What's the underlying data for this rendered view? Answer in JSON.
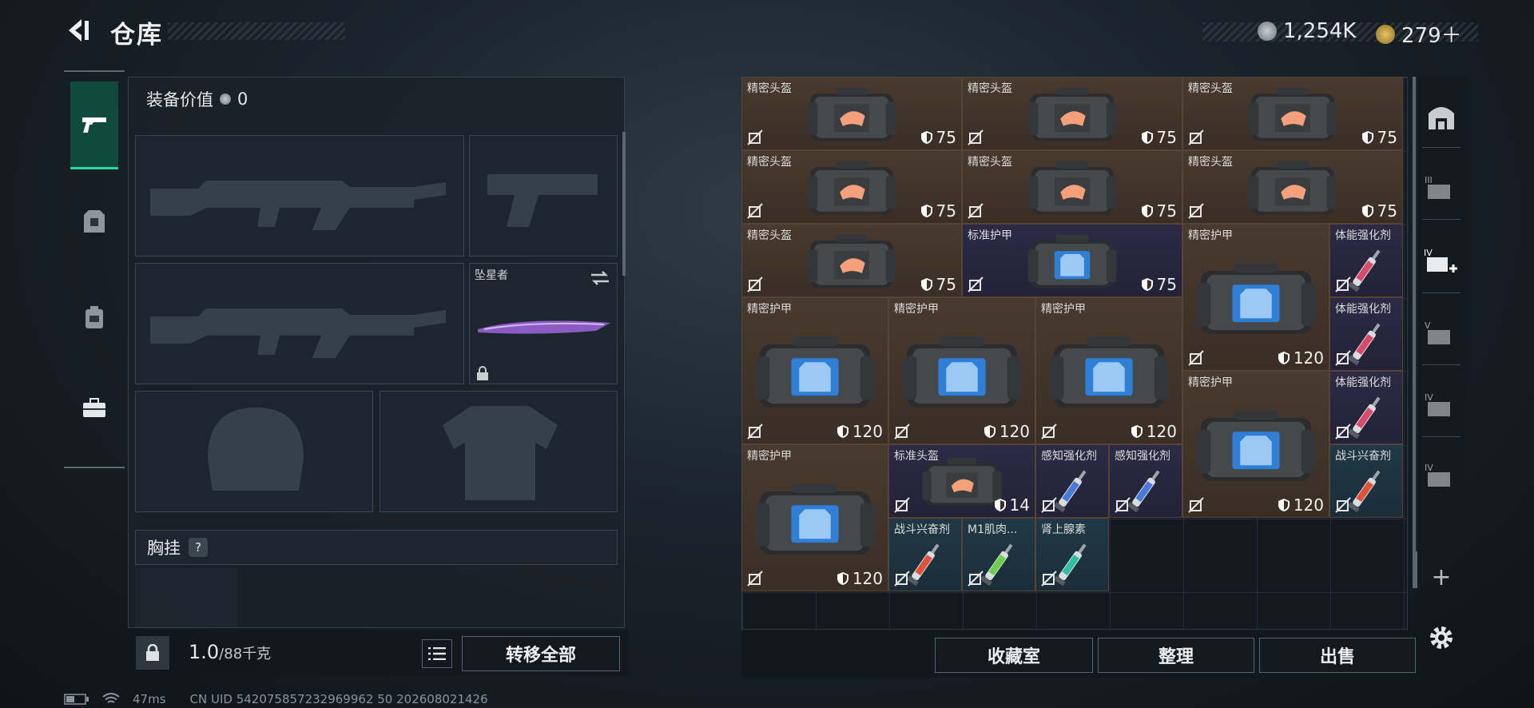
{
  "header": {
    "title": "仓库",
    "currency1": "1,254K",
    "currency2": "279＋"
  },
  "loadout": {
    "equipment_value_label": "装备价值",
    "equipment_value": "0",
    "melee_name": "坠星者",
    "chest_rig_label": "胸挂",
    "help_icon": "?",
    "weight": "1.0",
    "weight_capacity": "/88千克",
    "transfer_all_label": "转移全部"
  },
  "grid_items": [
    {
      "name": "精密头盔",
      "value": "75",
      "kind": "helmet",
      "color": "brown"
    },
    {
      "name": "精密头盔",
      "value": "75",
      "kind": "helmet",
      "color": "brown"
    },
    {
      "name": "精密头盔",
      "value": "75",
      "kind": "helmet",
      "color": "brown"
    },
    {
      "name": "精密头盔",
      "value": "75",
      "kind": "helmet",
      "color": "brown"
    },
    {
      "name": "精密头盔",
      "value": "75",
      "kind": "helmet",
      "color": "brown"
    },
    {
      "name": "精密头盔",
      "value": "75",
      "kind": "helmet",
      "color": "brown"
    },
    {
      "name": "精密头盔",
      "value": "75",
      "kind": "helmet",
      "color": "brown"
    },
    {
      "name": "标准护甲",
      "value": "75",
      "kind": "armor",
      "color": "purple"
    },
    {
      "name": "精密护甲",
      "value": "120",
      "kind": "armor",
      "color": "brown"
    },
    {
      "name": "体能强化剂",
      "value": "",
      "kind": "syringe",
      "color": "purple",
      "tint": "#d94a6a"
    },
    {
      "name": "精密护甲",
      "value": "120",
      "kind": "armor",
      "color": "brown"
    },
    {
      "name": "精密护甲",
      "value": "120",
      "kind": "armor",
      "color": "brown"
    },
    {
      "name": "精密护甲",
      "value": "120",
      "kind": "armor",
      "color": "brown"
    },
    {
      "name": "体能强化剂",
      "value": "",
      "kind": "syringe",
      "color": "purple",
      "tint": "#d94a6a"
    },
    {
      "name": "精密护甲",
      "value": "120",
      "kind": "armor",
      "color": "brown"
    },
    {
      "name": "体能强化剂",
      "value": "",
      "kind": "syringe",
      "color": "purple",
      "tint": "#d94a6a"
    },
    {
      "name": "精密护甲",
      "value": "120",
      "kind": "armor",
      "color": "brown"
    },
    {
      "name": "标准头盔",
      "value": "14",
      "kind": "helmet",
      "color": "purple"
    },
    {
      "name": "感知强化剂",
      "value": "",
      "kind": "syringe",
      "color": "purple",
      "tint": "#4a7ad9"
    },
    {
      "name": "感知强化剂",
      "value": "",
      "kind": "syringe",
      "color": "purple",
      "tint": "#4a7ad9"
    },
    {
      "name": "战斗兴奋剂",
      "value": "",
      "kind": "syringe",
      "color": "teal",
      "tint": "#e0523a"
    },
    {
      "name": "战斗兴奋剂",
      "value": "",
      "kind": "syringe",
      "color": "teal",
      "tint": "#e0523a"
    },
    {
      "name": "M1肌肉...",
      "value": "",
      "kind": "syringe",
      "color": "teal",
      "tint": "#6ad04a"
    },
    {
      "name": "肾上腺素",
      "value": "",
      "kind": "syringe",
      "color": "teal",
      "tint": "#2fc0a0"
    }
  ],
  "actions": {
    "collection": "收藏室",
    "sort": "整理",
    "sell": "出售"
  },
  "right_rail": {
    "plus": "+"
  },
  "status_bar": {
    "ping": "47ms",
    "uid": "CN UID 542075857232969962 50 202608021426"
  }
}
